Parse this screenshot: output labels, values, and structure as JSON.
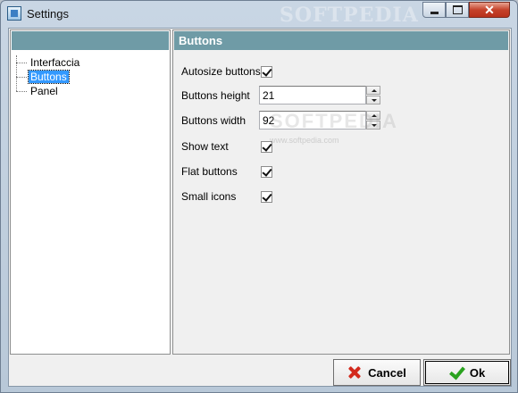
{
  "window": {
    "title": "Settings",
    "title_watermark": "SOFTPEDIA"
  },
  "controls": {
    "minimize": "—",
    "maximize": "□",
    "close": "✕"
  },
  "tree": {
    "items": [
      {
        "label": "Interfaccia",
        "selected": false
      },
      {
        "label": "Buttons",
        "selected": true
      },
      {
        "label": "Panel",
        "selected": false
      }
    ]
  },
  "panel": {
    "title": "Buttons",
    "autosize_label": "Autosize buttons",
    "autosize_checked": true,
    "height_label": "Buttons height",
    "height_value": "21",
    "width_label": "Buttons width",
    "width_value": "92",
    "show_text_label": "Show text",
    "show_text_checked": true,
    "flat_label": "Flat buttons",
    "flat_checked": true,
    "small_icons_label": "Small icons",
    "small_icons_checked": true
  },
  "watermark": {
    "big": "SOFTPEDIA",
    "small": "www.softpedia.com"
  },
  "buttons": {
    "cancel": "Cancel",
    "ok": "Ok"
  },
  "colors": {
    "header": "#6f9ba6",
    "selection": "#3399ff",
    "close_red": "#c5422b"
  }
}
